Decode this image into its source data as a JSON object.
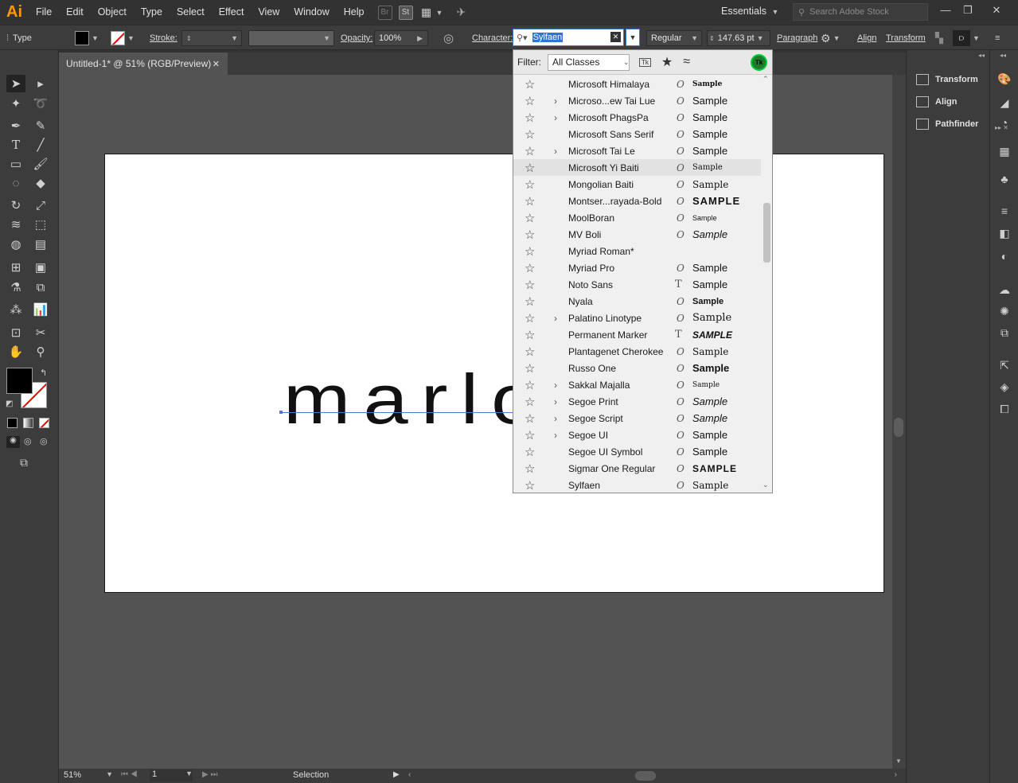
{
  "app": {
    "logo": "Ai",
    "menu": [
      "File",
      "Edit",
      "Object",
      "Type",
      "Select",
      "Effect",
      "View",
      "Window",
      "Help"
    ],
    "bridge_label": "Br",
    "stock_label": "St",
    "workspace": "Essentials",
    "search_placeholder": "Search Adobe Stock"
  },
  "control": {
    "tool_label": "Type",
    "stroke_label": "Stroke:",
    "opacity_label": "Opacity:",
    "opacity_value": "100%",
    "character_label": "Character:",
    "font_value": "Sylfaen",
    "style_value": "Regular",
    "size_value": "147.63 pt",
    "paragraph_label": "Paragraph",
    "align_label": "Align",
    "transform_label": "Transform"
  },
  "document": {
    "tab_title": "Untitled-1* @ 51% (RGB/Preview)",
    "art_text": "marlo"
  },
  "status": {
    "zoom": "51%",
    "artboard": "1",
    "mode": "Selection"
  },
  "panels": {
    "items": [
      "Transform",
      "Align",
      "Pathfinder"
    ]
  },
  "font_menu": {
    "filter_label": "Filter:",
    "filter_value": "All Classes",
    "fonts": [
      {
        "name": "Microsoft Himalaya",
        "expand": false,
        "type": "O",
        "sample": "Sample"
      },
      {
        "name": "Microso...ew Tai Lue",
        "expand": true,
        "type": "O",
        "sample": "Sample"
      },
      {
        "name": "Microsoft PhagsPa",
        "expand": true,
        "type": "O",
        "sample": "Sample"
      },
      {
        "name": "Microsoft Sans Serif",
        "expand": false,
        "type": "O",
        "sample": "Sample"
      },
      {
        "name": "Microsoft Tai Le",
        "expand": true,
        "type": "O",
        "sample": "Sample"
      },
      {
        "name": "Microsoft Yi Baiti",
        "expand": false,
        "type": "O",
        "sample": "Sample"
      },
      {
        "name": "Mongolian Baiti",
        "expand": false,
        "type": "O",
        "sample": "Sample"
      },
      {
        "name": "Montser...rayada-Bold",
        "expand": false,
        "type": "O",
        "sample": "SAMPLE"
      },
      {
        "name": "MoolBoran",
        "expand": false,
        "type": "O",
        "sample": "Sample"
      },
      {
        "name": "MV Boli",
        "expand": false,
        "type": "O",
        "sample": "Sample"
      },
      {
        "name": "Myriad Roman*",
        "expand": false,
        "type": "",
        "sample": ""
      },
      {
        "name": "Myriad Pro",
        "expand": false,
        "type": "O",
        "sample": "Sample"
      },
      {
        "name": "Noto Sans",
        "expand": false,
        "type": "T",
        "sample": "Sample"
      },
      {
        "name": "Nyala",
        "expand": false,
        "type": "O",
        "sample": "Sample"
      },
      {
        "name": "Palatino Linotype",
        "expand": true,
        "type": "O",
        "sample": "Sample"
      },
      {
        "name": "Permanent Marker",
        "expand": false,
        "type": "T",
        "sample": "SAMPLE"
      },
      {
        "name": "Plantagenet Cherokee",
        "expand": false,
        "type": "O",
        "sample": "Sample"
      },
      {
        "name": "Russo One",
        "expand": false,
        "type": "O",
        "sample": "Sample"
      },
      {
        "name": "Sakkal Majalla",
        "expand": true,
        "type": "O",
        "sample": "Sample"
      },
      {
        "name": "Segoe Print",
        "expand": true,
        "type": "O",
        "sample": "Sample"
      },
      {
        "name": "Segoe Script",
        "expand": true,
        "type": "O",
        "sample": "Sample"
      },
      {
        "name": "Segoe UI",
        "expand": true,
        "type": "O",
        "sample": "Sample"
      },
      {
        "name": "Segoe UI Symbol",
        "expand": false,
        "type": "O",
        "sample": "Sample"
      },
      {
        "name": "Sigmar One Regular",
        "expand": false,
        "type": "O",
        "sample": "SAMPLE"
      },
      {
        "name": "Sylfaen",
        "expand": false,
        "type": "O",
        "sample": "Sample"
      }
    ]
  }
}
